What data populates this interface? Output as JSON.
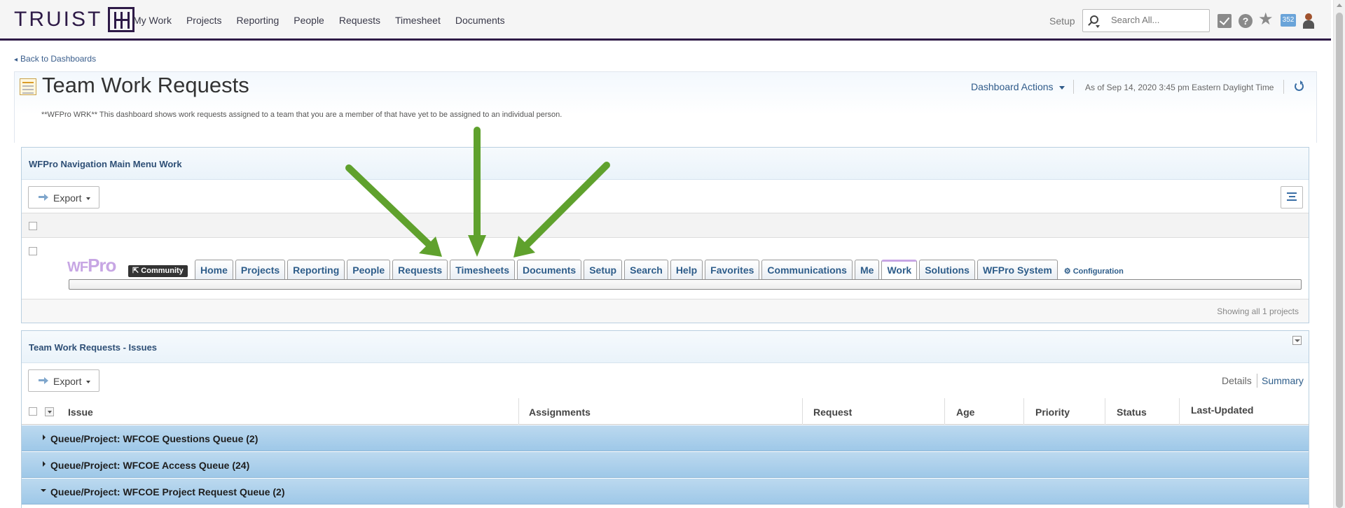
{
  "topnav": {
    "brand": "TRUIST",
    "links": [
      "My Work",
      "Projects",
      "Reporting",
      "People",
      "Requests",
      "Timesheet",
      "Documents"
    ],
    "setup_label": "Setup",
    "search_placeholder": "Search All...",
    "notification_count": "352"
  },
  "header": {
    "back_label": "Back to Dashboards",
    "title": "Team Work Requests",
    "dashboard_actions_label": "Dashboard Actions",
    "as_of": "As of  Sep 14, 2020 3:45 pm Eastern Daylight Time",
    "description": "**WFPro WRK** This dashboard shows work requests assigned to a team that you are a member of that have yet to be assigned to an individual person."
  },
  "nav_panel": {
    "title": "WFPro Navigation Main Menu Work",
    "export_label": "Export",
    "logo_text_a": "WF",
    "logo_text_b": "Pro",
    "community_label": "Community",
    "tabs": [
      "Home",
      "Projects",
      "Reporting",
      "People",
      "Requests",
      "Timesheets",
      "Documents",
      "Setup",
      "Search",
      "Help",
      "Favorites",
      "Communications",
      "Me",
      "Work",
      "Solutions",
      "WFPro System"
    ],
    "active_tab": "Work",
    "configuration_label": "Configuration",
    "showing_text": "Showing all 1 projects"
  },
  "issues_panel": {
    "title": "Team Work Requests - Issues",
    "export_label": "Export",
    "details_label": "Details",
    "summary_label": "Summary",
    "columns": [
      "Issue",
      "Assignments",
      "Request",
      "Age",
      "Priority",
      "Status",
      "Last-Updated"
    ],
    "groups": [
      {
        "label": "Queue/Project: WFCOE Questions Queue (2)",
        "expanded": false
      },
      {
        "label": "Queue/Project: WFCOE Access Queue (24)",
        "expanded": false
      },
      {
        "label": "Queue/Project: WFCOE Project Request Queue (2)",
        "expanded": true
      }
    ]
  },
  "colors": {
    "brand": "#2e1a47",
    "link": "#2e5d8a",
    "group_row": "#a9cfec",
    "annotation_arrow": "#5fa12d"
  }
}
